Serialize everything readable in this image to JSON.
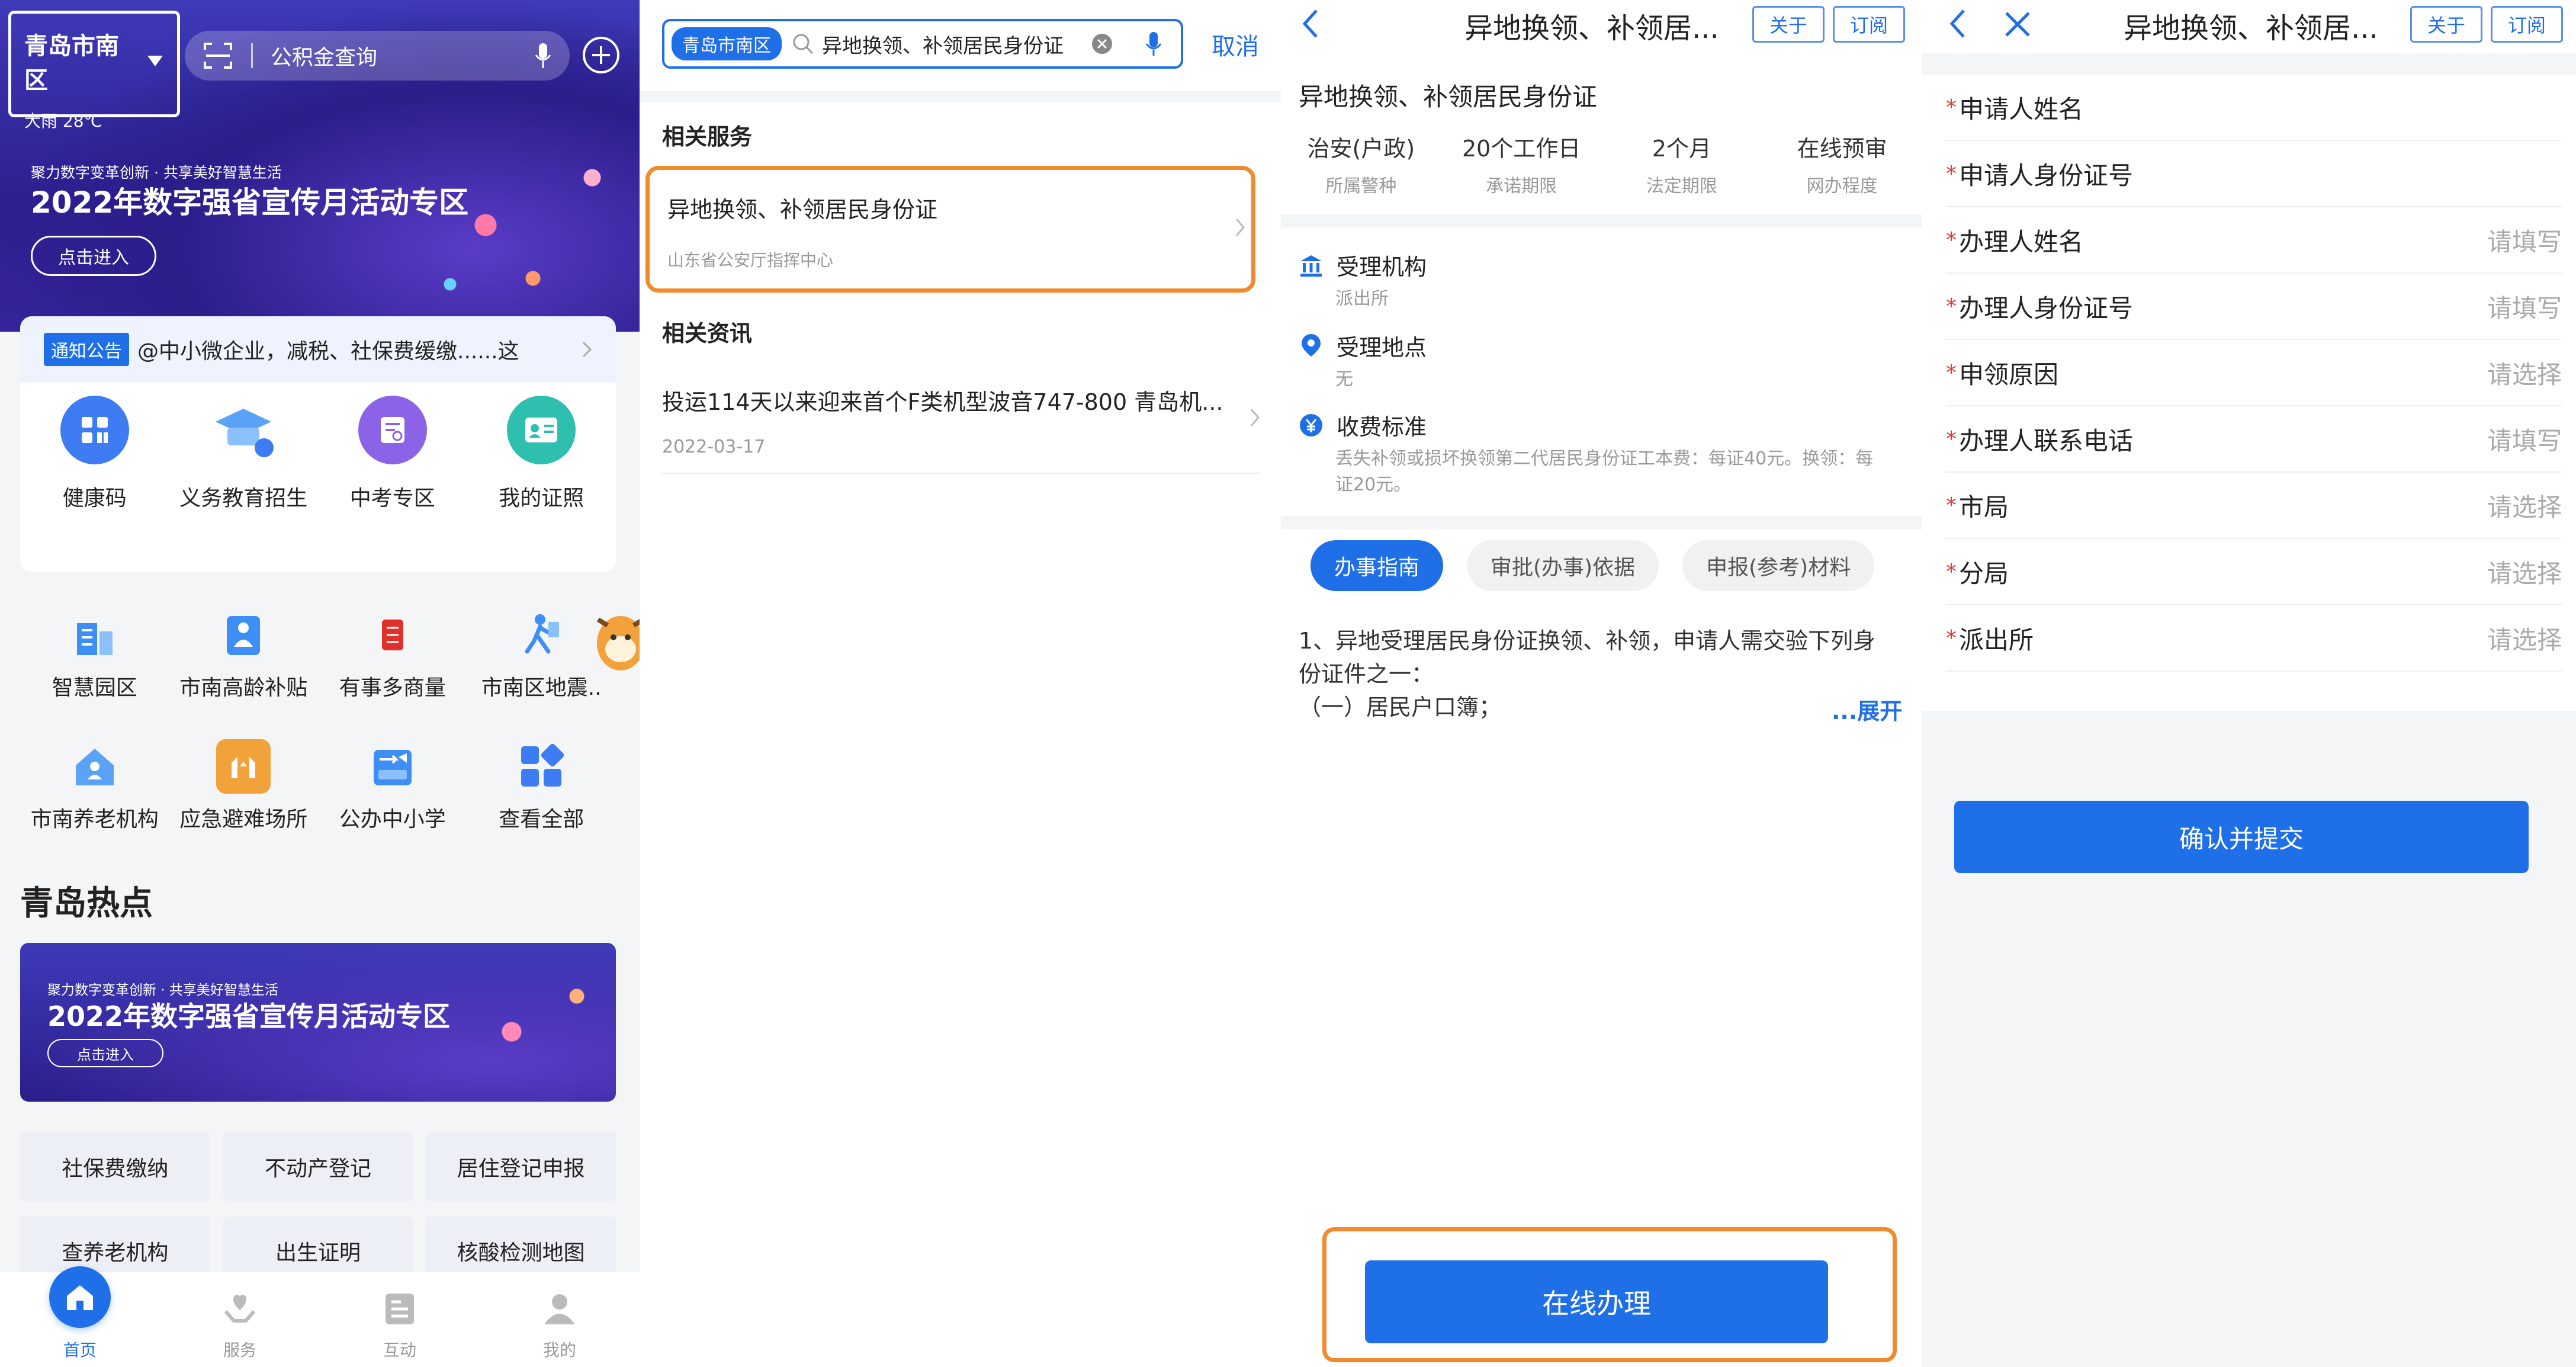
{
  "panel1": {
    "location": {
      "city": "青岛市南区",
      "weather": "大雨 28℃"
    },
    "search_placeholder": "公积金查询",
    "hero": {
      "slogan": "聚力数字变革创新 · 共享美好智慧生活",
      "title": "2022年数字强省宣传月活动专区",
      "button": "点击进入"
    },
    "notice": {
      "tag": "通知公告",
      "text": "@中小微企业，减税、社保费缓缴......这"
    },
    "main_services": [
      {
        "label": "健康码",
        "color": "#3d7cf2"
      },
      {
        "label": "义务教育招生",
        "color": "#5aa2f5"
      },
      {
        "label": "中考专区",
        "color": "#8a63e6"
      },
      {
        "label": "我的证照",
        "color": "#2fbfae"
      }
    ],
    "services_row2": [
      {
        "label": "智慧园区",
        "color": "#3d8ef5"
      },
      {
        "label": "市南高龄补贴",
        "color": "#3d8ef5"
      },
      {
        "label": "有事多商量",
        "color": "#e0302a"
      },
      {
        "label": "市南区地震..",
        "color": "#3d8ef5"
      }
    ],
    "services_row3": [
      {
        "label": "市南养老机构",
        "color": "#5aa2f5"
      },
      {
        "label": "应急避难场所",
        "color": "#f2a23a"
      },
      {
        "label": "公办中小学",
        "color": "#3d8ef5"
      },
      {
        "label": "查看全部",
        "color": "#3d7cf2"
      }
    ],
    "hot_title": "青岛热点",
    "banner2": {
      "slogan": "聚力数字变革创新 · 共享美好智慧生活",
      "title": "2022年数字强省宣传月活动专区",
      "button": "点击进入"
    },
    "chips": [
      "社保费缴纳",
      "不动产登记",
      "居住登记申报",
      "查养老机构",
      "出生证明",
      "核酸检测地图"
    ],
    "tabs": [
      "首页",
      "服务",
      "互动",
      "我的"
    ]
  },
  "panel2": {
    "search": {
      "city_tag": "青岛市南区",
      "query": "异地换领、补领居民身份证"
    },
    "cancel": "取消",
    "related_services_title": "相关服务",
    "service_result": {
      "title": "异地换领、补领居民身份证",
      "dept": "山东省公安厅指挥中心"
    },
    "related_news_title": "相关资讯",
    "news": {
      "title": "投运114天以来迎来首个F类机型波音747-800 青岛机...",
      "date": "2022-03-17"
    }
  },
  "panel3": {
    "header_title": "异地换领、补领居...",
    "about": "关于",
    "subscribe": "订阅",
    "service_title": "异地换领、补领居民身份证",
    "stats": [
      {
        "value": "治安(户政)",
        "label": "所属警种"
      },
      {
        "value": "20个工作日",
        "label": "承诺期限"
      },
      {
        "value": "2个月",
        "label": "法定期限"
      },
      {
        "value": "在线预审",
        "label": "网办程度"
      }
    ],
    "agency": {
      "label": "受理机构",
      "value": "派出所"
    },
    "place": {
      "label": "受理地点",
      "value": "无"
    },
    "fee": {
      "label": "收费标准",
      "value": "丢失补领或损坏换领第二代居民身份证工本费：每证40元。换领：每证20元。"
    },
    "tabs": [
      "办事指南",
      "审批(办事)依据",
      "申报(参考)材料"
    ],
    "guide_text": "1、异地受理居民身份证换领、补领，申请人需交验下列身份证件之一：",
    "guide_item": "（一）居民户口簿；",
    "expand": "...展开",
    "online_button": "在线办理"
  },
  "panel4": {
    "header_title": "异地换领、补领居...",
    "about": "关于",
    "subscribe": "订阅",
    "fields": [
      {
        "label": "申请人姓名",
        "placeholder": ""
      },
      {
        "label": "申请人身份证号",
        "placeholder": ""
      },
      {
        "label": "办理人姓名",
        "placeholder": "请填写"
      },
      {
        "label": "办理人身份证号",
        "placeholder": "请填写"
      },
      {
        "label": "申领原因",
        "placeholder": "请选择"
      },
      {
        "label": "办理人联系电话",
        "placeholder": "请填写"
      },
      {
        "label": "市局",
        "placeholder": "请选择"
      },
      {
        "label": "分局",
        "placeholder": "请选择"
      },
      {
        "label": "派出所",
        "placeholder": "请选择"
      }
    ],
    "submit_button": "确认并提交"
  }
}
